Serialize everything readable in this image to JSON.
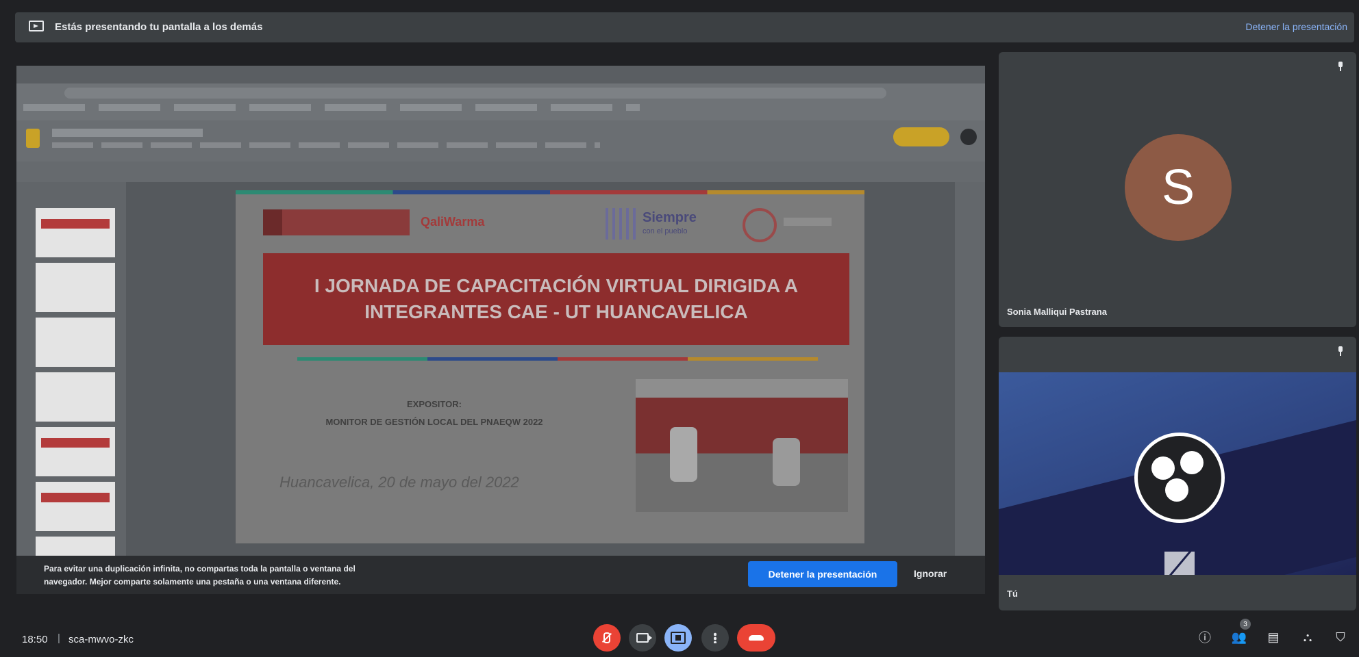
{
  "banner": {
    "message": "Estás presentando tu pantalla a los demás",
    "stop_link": "Detener la presentación"
  },
  "shared_screen": {
    "slide": {
      "logo_text": "QaliWarma",
      "siempre_title": "Siempre",
      "siempre_sub": "con el pueblo",
      "headline": "I JORNADA DE CAPACITACIÓN VIRTUAL DIRIGIDA A\nINTEGRANTES CAE - UT HUANCAVELICA",
      "expositor": "EXPOSITOR:\nMONITOR DE GESTIÓN LOCAL DEL PNAEQW 2022",
      "date": "Huancavelica, 20 de mayo del 2022"
    }
  },
  "warning": {
    "text": "Para evitar una duplicación infinita, no compartas toda la pantalla o ventana del\nnavegador. Mejor comparte solamente una pestaña o una ventana diferente.",
    "stop_button": "Detener la presentación",
    "ignore_button": "Ignorar"
  },
  "participants": [
    {
      "initial": "S",
      "name": "Sonia Malliqui Pastrana",
      "avatar_color": "#8d5a45"
    },
    {
      "name": "Tú"
    }
  ],
  "bottombar": {
    "time": "18:50",
    "separator": "|",
    "meeting_code": "sca-mwvo-zkc",
    "people_count": "3"
  },
  "colors": {
    "accent": "#1a73e8",
    "danger": "#ea4335",
    "present_active": "#8ab4f8"
  }
}
